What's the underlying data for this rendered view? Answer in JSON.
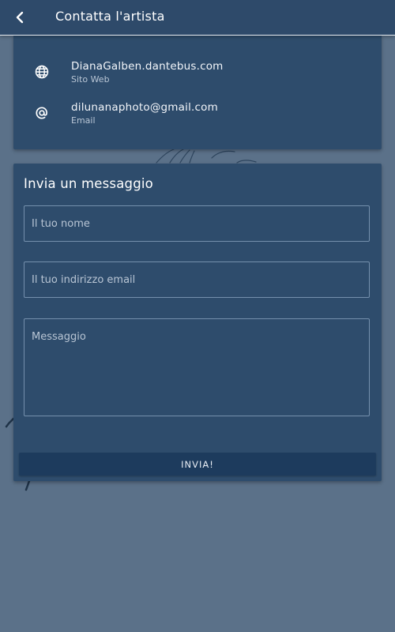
{
  "app_bar": {
    "title": "Contatta l'artista",
    "back_icon": "back-arrow-icon"
  },
  "contacts": [
    {
      "icon": "globe-icon",
      "value": "DianaGalben.dantebus.com",
      "label": "Sito Web"
    },
    {
      "icon": "at-sign-icon",
      "value": "dilunanaphoto@gmail.com",
      "label": "Email"
    }
  ],
  "form": {
    "title": "Invia un messaggio",
    "name_placeholder": "Il tuo nome",
    "email_placeholder": "Il tuo indirizzo email",
    "message_placeholder": "Messaggio",
    "send_label": "INVIA!"
  },
  "colors": {
    "background": "#5b7189",
    "app_bar": "#2e4a6a",
    "card": "#2e4c6c",
    "button": "#1d3b5d"
  }
}
